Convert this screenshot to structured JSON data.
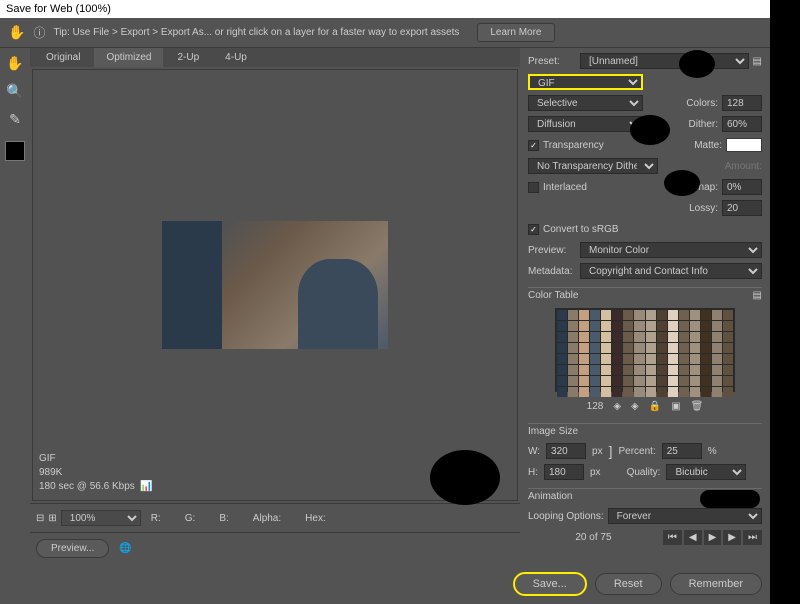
{
  "title": "Save for Web (100%)",
  "tip": {
    "text": "Tip: Use File > Export > Export As... or right click on a layer for a faster way to export assets",
    "learn_more": "Learn More"
  },
  "tabs": [
    "Original",
    "Optimized",
    "2-Up",
    "4-Up"
  ],
  "active_tab": 1,
  "preview_meta": {
    "format": "GIF",
    "size": "989K",
    "time": "180 sec @ 56.6 Kbps"
  },
  "zoom": "100%",
  "info": {
    "R": "R:",
    "G": "G:",
    "B": "B:",
    "Alpha": "Alpha:",
    "Hex": "Hex:"
  },
  "preview_btn": "Preview...",
  "settings": {
    "preset_label": "Preset:",
    "preset": "[Unnamed]",
    "format": "GIF",
    "reduction": "Selective",
    "colors_label": "Colors:",
    "colors": "128",
    "dither_method": "Diffusion",
    "dither_label": "Dither:",
    "dither": "60%",
    "transparency": "Transparency",
    "matte_label": "Matte:",
    "no_trans_dither": "No Transparency Dither",
    "amount_label": "Amount:",
    "interlaced": "Interlaced",
    "websnap_label": "Web Snap:",
    "websnap": "0%",
    "lossy_label": "Lossy:",
    "lossy": "20",
    "convert_srgb": "Convert to sRGB",
    "preview_label": "Preview:",
    "preview": "Monitor Color",
    "metadata_label": "Metadata:",
    "metadata": "Copyright and Contact Info",
    "color_table": "Color Table",
    "ct_count": "128",
    "image_size": "Image Size",
    "w_label": "W:",
    "w": "320",
    "h_label": "H:",
    "h": "180",
    "px": "px",
    "percent_label": "Percent:",
    "percent": "25",
    "pct": "%",
    "quality_label": "Quality:",
    "quality": "Bicubic",
    "animation": "Animation",
    "loop_label": "Looping Options:",
    "loop": "Forever",
    "frame": "20 of 75"
  },
  "buttons": {
    "save": "Save...",
    "reset": "Reset",
    "remember": "Remember"
  }
}
